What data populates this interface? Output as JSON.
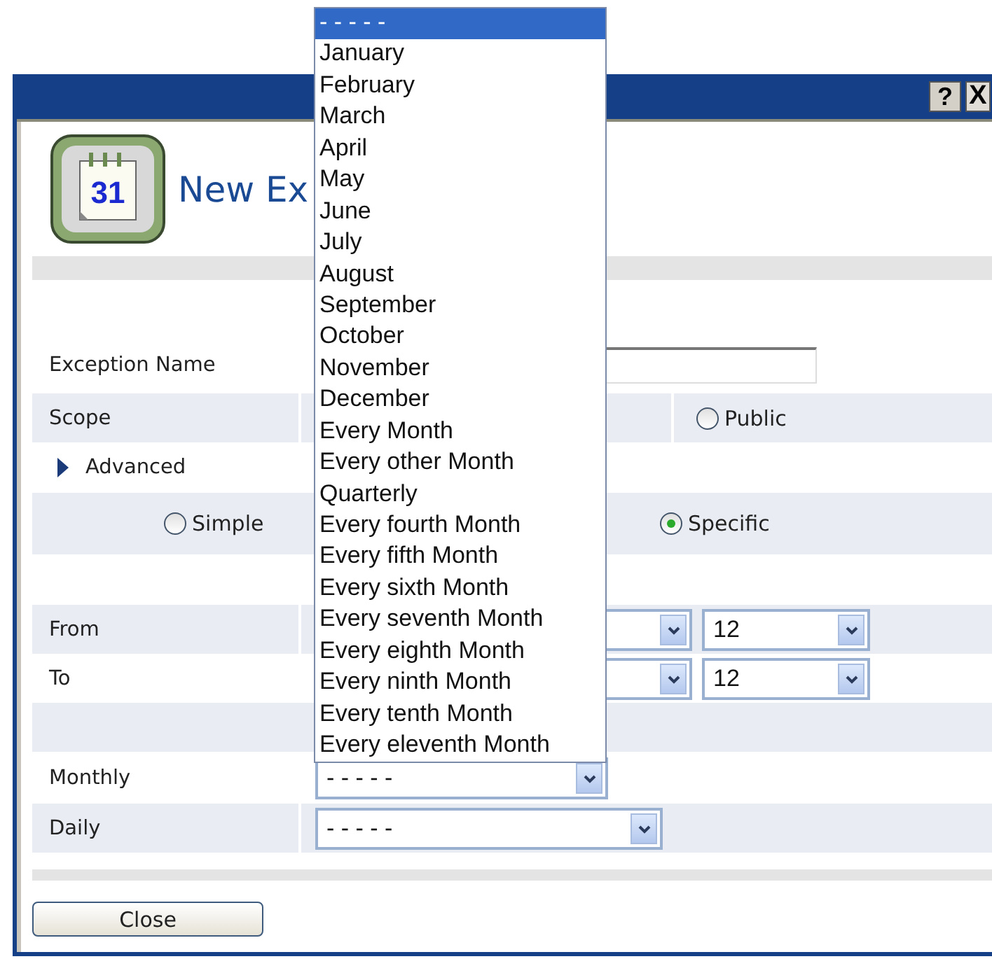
{
  "window": {
    "buttons": [
      {
        "kind": "help",
        "label": "?"
      },
      {
        "kind": "close",
        "label": "X"
      }
    ]
  },
  "header": {
    "icon_text": "31",
    "title": "New Ex"
  },
  "form": {
    "exception_name": {
      "label": "Exception Name"
    },
    "scope": {
      "label": "Scope",
      "options": [
        {
          "label": "Public",
          "selected": false
        }
      ]
    },
    "advanced": {
      "label": "Advanced",
      "expanded": false
    },
    "mode": {
      "options": [
        {
          "label": "Simple",
          "selected": false
        },
        {
          "label": "Specific",
          "selected": true
        }
      ]
    },
    "from": {
      "label": "From",
      "selects": [
        {
          "kind": "select"
        },
        {
          "kind": "select",
          "value": "12"
        }
      ]
    },
    "to": {
      "label": "To",
      "selects": [
        {
          "kind": "select"
        },
        {
          "kind": "select",
          "value": "12"
        }
      ]
    },
    "monthly": {
      "label": "Monthly",
      "value": "- - - - -",
      "open": true,
      "options": [
        {
          "label": "- - - - -",
          "selected": true
        },
        {
          "label": "January",
          "selected": false
        },
        {
          "label": "February",
          "selected": false
        },
        {
          "label": "March",
          "selected": false
        },
        {
          "label": "April",
          "selected": false
        },
        {
          "label": "May",
          "selected": false
        },
        {
          "label": "June",
          "selected": false
        },
        {
          "label": "July",
          "selected": false
        },
        {
          "label": "August",
          "selected": false
        },
        {
          "label": "September",
          "selected": false
        },
        {
          "label": "October",
          "selected": false
        },
        {
          "label": "November",
          "selected": false
        },
        {
          "label": "December",
          "selected": false
        },
        {
          "label": "Every Month",
          "selected": false
        },
        {
          "label": "Every other Month",
          "selected": false
        },
        {
          "label": "Quarterly",
          "selected": false
        },
        {
          "label": "Every fourth Month",
          "selected": false
        },
        {
          "label": "Every fifth Month",
          "selected": false
        },
        {
          "label": "Every sixth Month",
          "selected": false
        },
        {
          "label": "Every seventh Month",
          "selected": false
        },
        {
          "label": "Every eighth Month",
          "selected": false
        },
        {
          "label": "Every ninth Month",
          "selected": false
        },
        {
          "label": "Every tenth Month",
          "selected": false
        },
        {
          "label": "Every eleventh Month",
          "selected": false
        }
      ]
    },
    "daily": {
      "label": "Daily",
      "value": "- - - - -"
    }
  },
  "buttons": [
    {
      "label": "Close"
    }
  ]
}
